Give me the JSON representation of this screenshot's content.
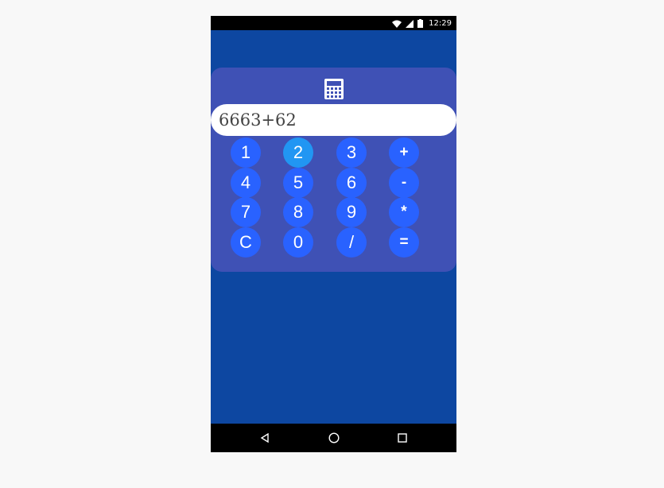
{
  "status_bar": {
    "time": "12:29",
    "icons": [
      "wifi-icon",
      "signal-icon",
      "battery-icon"
    ]
  },
  "app": {
    "icon": "calculator-icon",
    "display_value": "6663+62",
    "keys": [
      {
        "label": "1",
        "name": "key-1",
        "active": false
      },
      {
        "label": "2",
        "name": "key-2",
        "active": true
      },
      {
        "label": "3",
        "name": "key-3",
        "active": false
      },
      {
        "label": "+",
        "name": "key-plus",
        "active": false
      },
      {
        "label": "4",
        "name": "key-4",
        "active": false
      },
      {
        "label": "5",
        "name": "key-5",
        "active": false
      },
      {
        "label": "6",
        "name": "key-6",
        "active": false
      },
      {
        "label": "-",
        "name": "key-minus",
        "active": false
      },
      {
        "label": "7",
        "name": "key-7",
        "active": false
      },
      {
        "label": "8",
        "name": "key-8",
        "active": false
      },
      {
        "label": "9",
        "name": "key-9",
        "active": false
      },
      {
        "label": "*",
        "name": "key-multiply",
        "active": false
      },
      {
        "label": "C",
        "name": "key-clear",
        "active": false
      },
      {
        "label": "0",
        "name": "key-0",
        "active": false
      },
      {
        "label": "/",
        "name": "key-divide",
        "active": false
      },
      {
        "label": "=",
        "name": "key-equals",
        "active": false
      }
    ]
  },
  "nav_bar": {
    "buttons": [
      "back-icon",
      "home-icon",
      "recents-icon"
    ]
  },
  "colors": {
    "background": "#0d47a1",
    "card": "#3f51b5",
    "key": "#2962ff",
    "key_active": "#2196f3"
  }
}
